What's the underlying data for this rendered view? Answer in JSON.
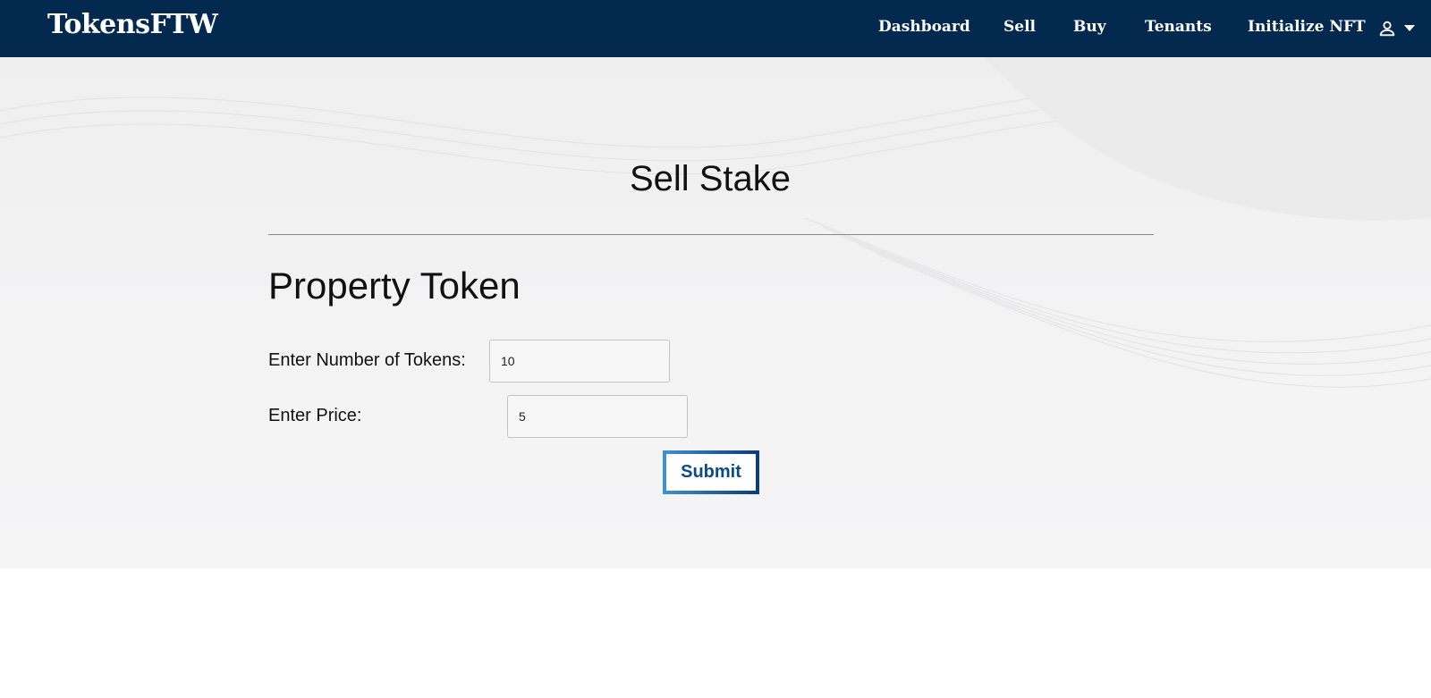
{
  "app": {
    "brand": "TokensFTW"
  },
  "nav": {
    "items": [
      {
        "label": "Dashboard"
      },
      {
        "label": "Sell"
      },
      {
        "label": "Buy"
      },
      {
        "label": "Tenants"
      },
      {
        "label": "Initialize NFT"
      }
    ],
    "user_icon": "person-icon",
    "dropdown_icon": "caret-down-icon"
  },
  "page": {
    "title": "Sell Stake",
    "section_title": "Property Token"
  },
  "form": {
    "tokens_label": "Enter Number of Tokens:",
    "tokens_value": "10",
    "price_label": "Enter Price:",
    "price_value": "5",
    "submit_label": "Submit"
  },
  "colors": {
    "navbar": "#03294f",
    "accent": "#0f4a82"
  }
}
